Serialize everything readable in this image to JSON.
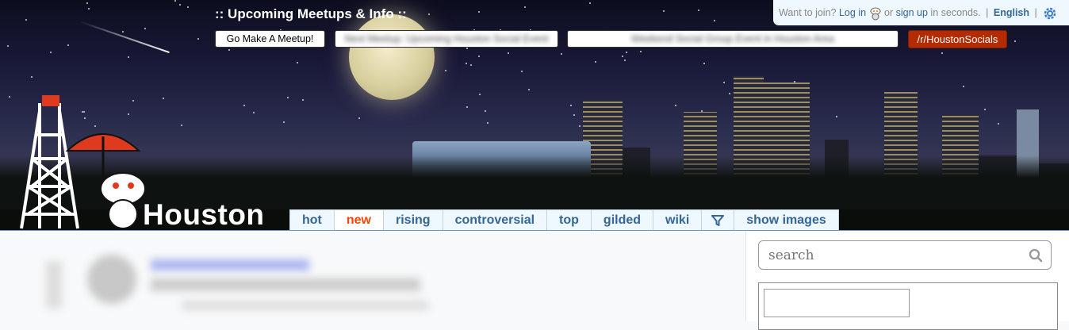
{
  "header": {
    "meetups_title": ":: Upcoming Meetups & Info ::",
    "make_meetup_label": "Go Make A Meetup!",
    "meetup_link_1": "Next Meetup: Upcoming Houston Social Event",
    "meetup_link_2": "Weekend Social Group Event in Houston Area",
    "socials_label": "/r/HoustonSocials",
    "logo_text": "Houston"
  },
  "userbar": {
    "prompt": "Want to join?",
    "login_label": "Log in",
    "or_text": "or",
    "signup_label": "sign up",
    "suffix": "in seconds.",
    "language": "English",
    "sep": "|"
  },
  "tabs": [
    {
      "label": "hot"
    },
    {
      "label": "new",
      "selected": true
    },
    {
      "label": "rising"
    },
    {
      "label": "controversial"
    },
    {
      "label": "top"
    },
    {
      "label": "gilded"
    },
    {
      "label": "wiki"
    },
    {
      "label": "",
      "icon": "filter-icon"
    },
    {
      "label": "show images"
    }
  ],
  "sidebar": {
    "search_placeholder": "search"
  },
  "colors": {
    "accent": "#336699",
    "selected_tab": "#ff4500",
    "socials_button": "#b32b00"
  }
}
